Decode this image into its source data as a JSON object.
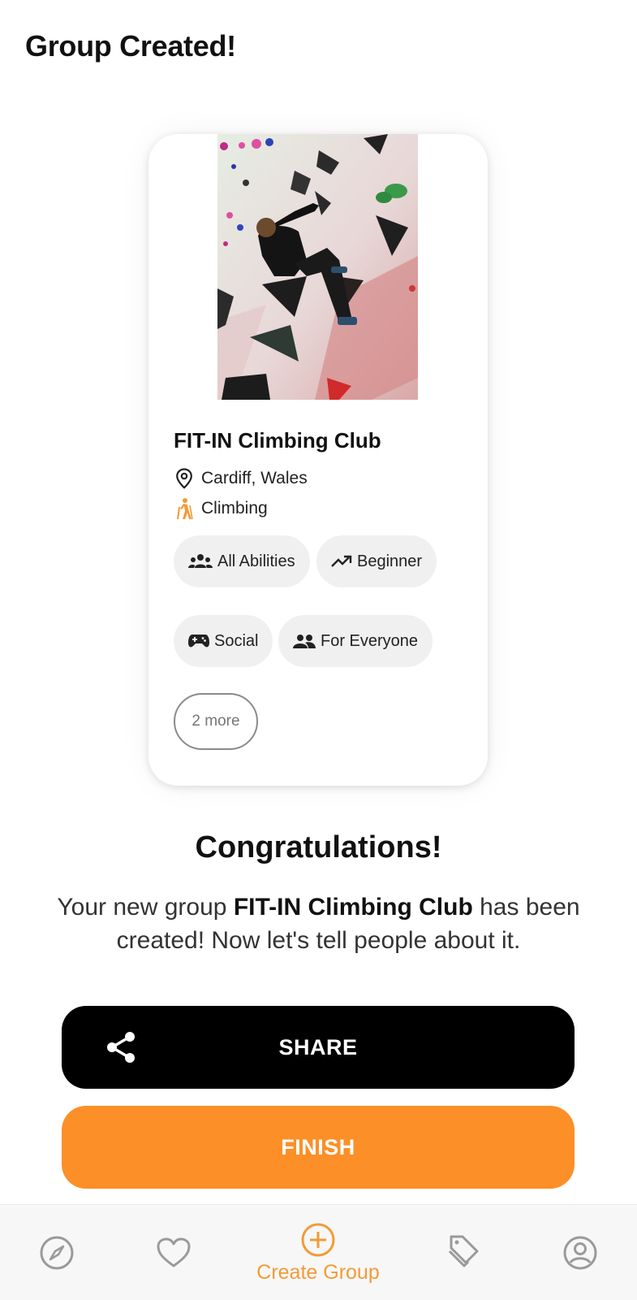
{
  "header": {
    "title": "Group Created!"
  },
  "card": {
    "title": "FIT-IN Climbing Club",
    "location": "Cardiff, Wales",
    "sport": "Climbing",
    "chips": [
      {
        "label": "All Abilities",
        "icon": "group-icon"
      },
      {
        "label": "Beginner",
        "icon": "trending-up-icon"
      },
      {
        "label": "Social",
        "icon": "gamepad-icon"
      },
      {
        "label": "For Everyone",
        "icon": "people-icon"
      }
    ],
    "more_label": "2 more"
  },
  "congrats": {
    "heading": "Congratulations!",
    "body_prefix": "Your new group ",
    "body_group": "FIT-IN Climbing Club",
    "body_suffix": " has been created! Now let's tell people about it."
  },
  "buttons": {
    "share_label": "SHARE",
    "finish_label": "FINISH"
  },
  "nav": {
    "items": [
      {
        "icon": "compass-icon",
        "label": ""
      },
      {
        "icon": "heart-icon",
        "label": ""
      },
      {
        "icon": "plus-circle-icon",
        "label": "Create Group",
        "active": true
      },
      {
        "icon": "tag-icon",
        "label": ""
      },
      {
        "icon": "account-icon",
        "label": ""
      }
    ]
  },
  "colors": {
    "accent": "#fc8f27",
    "share_button": "#000000",
    "nav_active": "#f39a37",
    "nav_inactive": "#9a9a9a"
  }
}
